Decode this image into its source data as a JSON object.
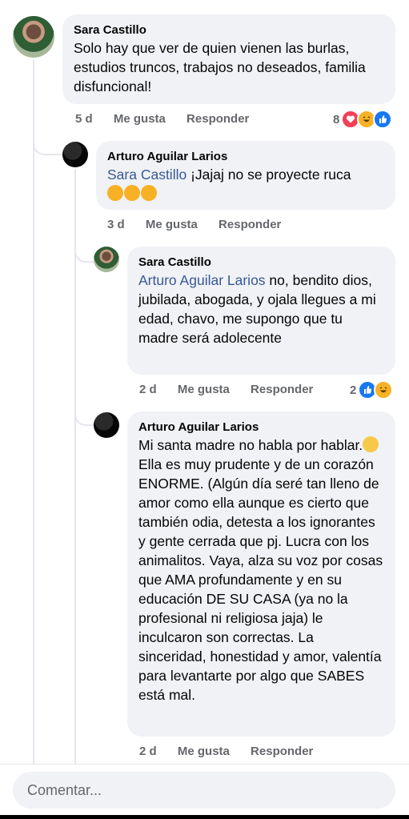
{
  "comments": [
    {
      "author": "Sara Castillo",
      "text": "Solo hay que ver de quien vienen las burlas, estudios truncos, trabajos no deseados, familia disfuncional!",
      "time": "5 d",
      "like": "Me gusta",
      "reply": "Responder",
      "reaction_count": "8",
      "reaction_icons": [
        "love-icon",
        "haha-icon",
        "like-icon"
      ]
    },
    {
      "author": "Arturo Aguilar Larios",
      "mention": "Sara Castillo",
      "text": " ¡Jajaj no se proyecte ruca",
      "emoji_line": [
        "rofl-icon",
        "rofl-icon",
        "rofl-icon"
      ],
      "time": "3 d",
      "like": "Me gusta",
      "reply": "Responder"
    },
    {
      "author": "Sara Castillo",
      "mention": "Arturo Aguilar Larios",
      "text": " no, bendito dios, jubilada, abogada, y ojala llegues a mi edad, chavo, me supongo que tu madre será adolecente",
      "time": "2 d",
      "like": "Me gusta",
      "reply": "Responder",
      "reaction_count": "2",
      "reaction_icons": [
        "like-icon",
        "haha-icon"
      ]
    },
    {
      "author": "Arturo Aguilar Larios",
      "text_a": "Mi santa madre no habla por hablar.",
      "emoji": "smiling-face-icon",
      "text_b": " Ella es muy prudente y de un corazón ENORME. (Algún día seré tan lleno de amor como ella aunque es cierto que también odia, detesta a los ignorantes y gente cerrada que pj. Lucra con los animalitos. Vaya, alza su voz por cosas que AMA profundamente y en su educación DE SU CASA (ya no la profesional ni religiosa jaja) le inculcaron son correctas. La sinceridad, honestidad y amor, valentía para levantarte por algo que SABES está mal.",
      "time": "2 d",
      "like": "Me gusta",
      "reply": "Responder"
    }
  ],
  "composer": {
    "placeholder": "Comentar..."
  },
  "colors": {
    "bubble": "#f0f2f5",
    "mention": "#385898",
    "meta": "#65676b",
    "like": "#1877f2",
    "love": "#f33e58",
    "haha": "#f7b125"
  }
}
